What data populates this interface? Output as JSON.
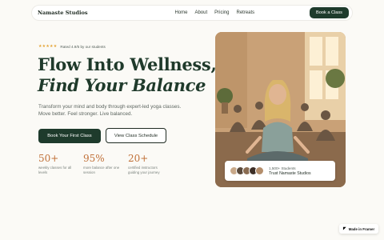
{
  "nav": {
    "logo": "Namaste Studios",
    "links": [
      "Home",
      "About",
      "Pricing",
      "Retreats"
    ],
    "cta": "Book a Class"
  },
  "hero": {
    "rating_text": "Rated 4.9/5 by our students",
    "stars": "★★★★★",
    "title_line1": "Flow Into Wellness,",
    "title_line2": "Find Your Balance",
    "subtitle": "Transform your mind and body through expert-led yoga classes. Move better. Feel stronger. Live balanced.",
    "primary_button": "Book Your First Class",
    "secondary_button": "View Class Schedule",
    "stats": [
      {
        "value": "50+",
        "label": "weekly classes for all levels"
      },
      {
        "value": "95%",
        "label": "more balance after one session"
      },
      {
        "value": "20+",
        "label": "certified instructors guiding your journey"
      }
    ]
  },
  "trust": {
    "count": "1,500+ Students",
    "label": "Trust Namaste Studios"
  },
  "badge": {
    "text": "Made in Framer"
  },
  "colors": {
    "accent": "#1e3b2c",
    "stat": "#c1723a",
    "star": "#e4a435"
  }
}
